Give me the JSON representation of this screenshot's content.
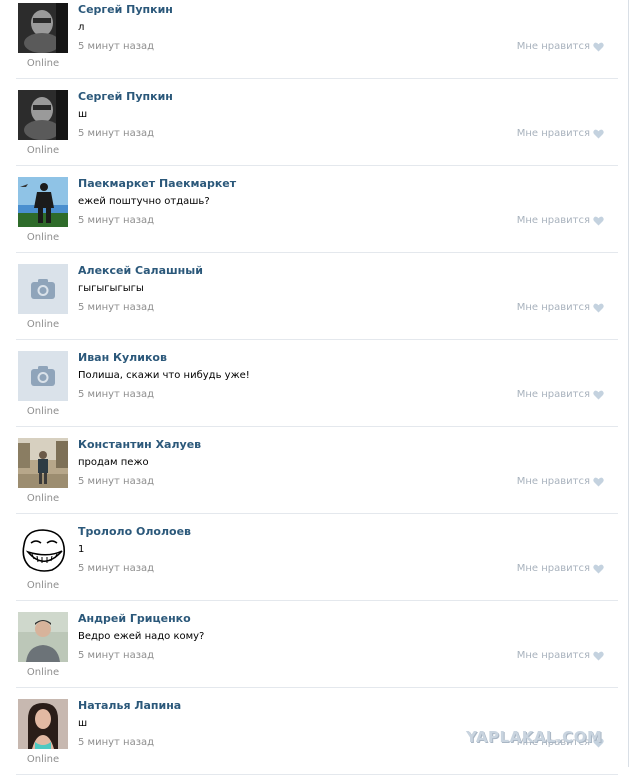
{
  "online_label": "Online",
  "like_label": "Мне нравится",
  "watermark": "YAPLAKAL.COM",
  "comments": [
    {
      "author": "Сергей Пупкин",
      "text": "л",
      "time": "5 минут назад",
      "avatar": "bw-face"
    },
    {
      "author": "Сергей Пупкин",
      "text": "ш",
      "time": "5 минут назад",
      "avatar": "bw-face"
    },
    {
      "author": "Паекмаркет Паекмаркет",
      "text": "ежей поштучно отдашь?",
      "time": "5 минут назад",
      "avatar": "traveler-photo"
    },
    {
      "author": "Алексей Салашный",
      "text": "гыгыгыгыгы",
      "time": "5 минут назад",
      "avatar": "camera-placeholder"
    },
    {
      "author": "Иван Куликов",
      "text": "Полиша, скажи что нибудь уже!",
      "time": "5 минут назад",
      "avatar": "camera-placeholder"
    },
    {
      "author": "Константин Халуев",
      "text": "продам пежо",
      "time": "5 минут назад",
      "avatar": "street-photo"
    },
    {
      "author": "Трололо Ололоев",
      "text": "1",
      "time": "5 минут назад",
      "avatar": "troll-face"
    },
    {
      "author": "Андрей Гриценко",
      "text": "Ведро ежей надо кому?",
      "time": "5 минут назад",
      "avatar": "man-photo"
    },
    {
      "author": "Наталья Лапина",
      "text": "ш",
      "time": "5 минут назад",
      "avatar": "woman-photo"
    }
  ]
}
